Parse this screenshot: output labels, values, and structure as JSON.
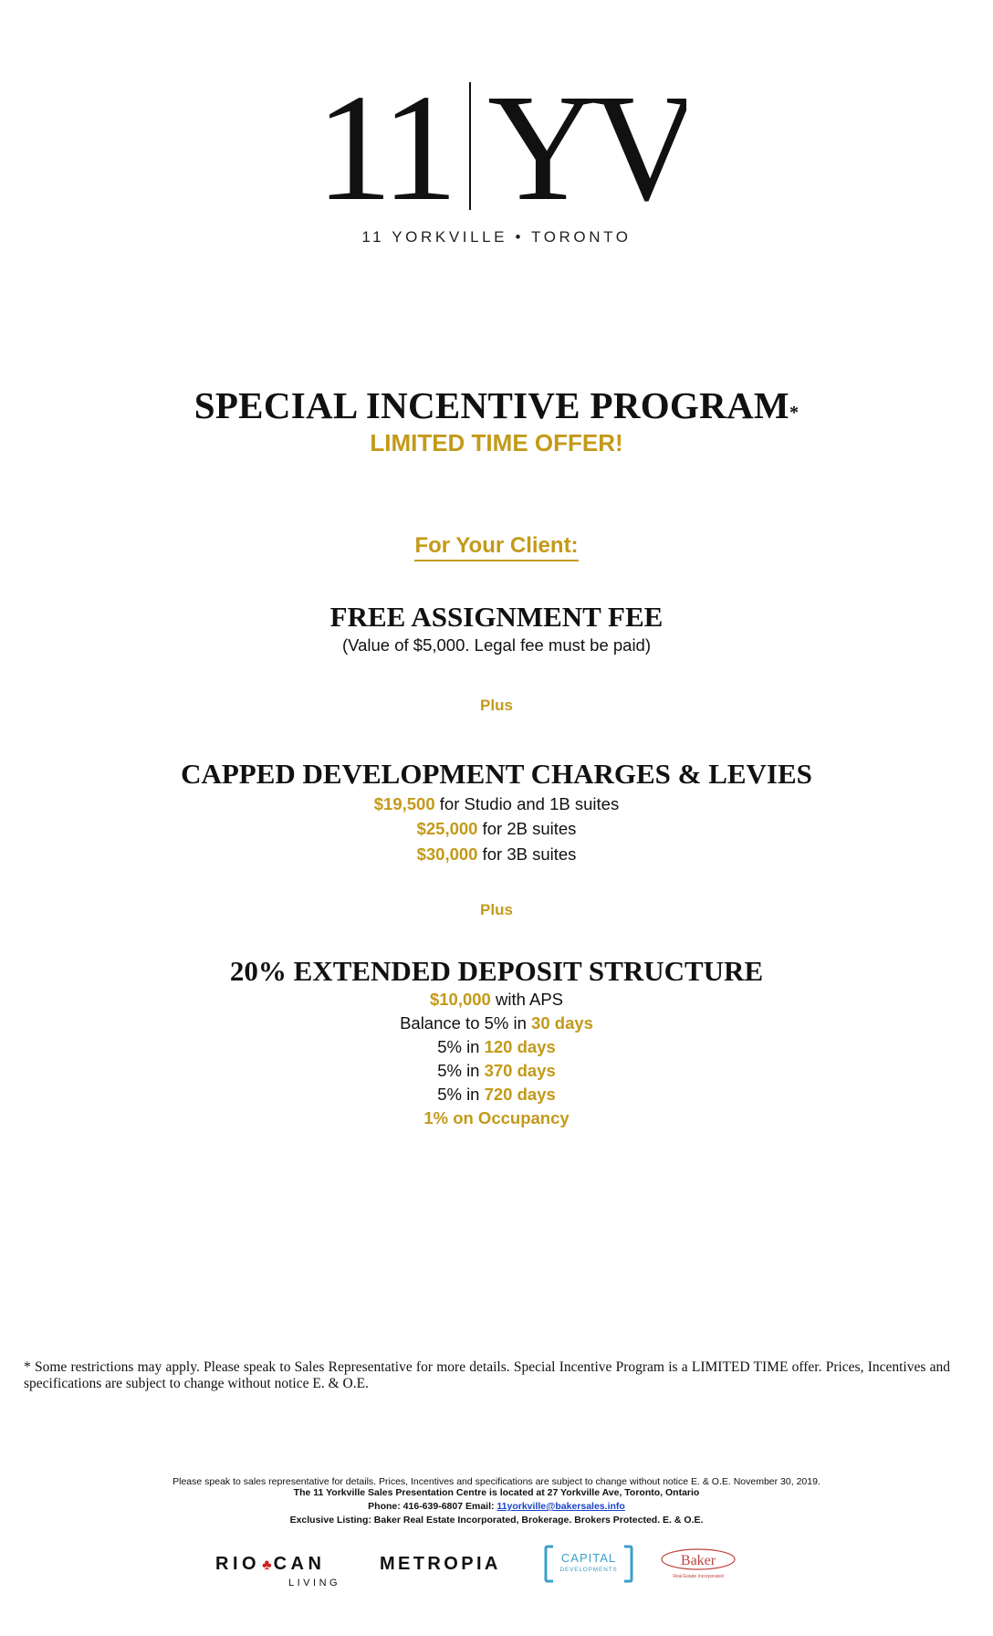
{
  "logo": {
    "left": "11",
    "right": "YV",
    "subtitle": "11 YORKVILLE • TORONTO"
  },
  "heading": {
    "title": "SPECIAL INCENTIVE PROGRAM",
    "asterisk": "*",
    "offer": "LIMITED TIME OFFER!"
  },
  "for_client": "For Your Client:",
  "assignment": {
    "title": "FREE ASSIGNMENT FEE",
    "note": "(Value of $5,000. Legal fee must be paid)"
  },
  "plus_label": "Plus",
  "capped": {
    "title": "CAPPED DEVELOPMENT CHARGES & LEVIES",
    "items": [
      {
        "amount": "$19,500",
        "text": " for Studio and 1B suites"
      },
      {
        "amount": "$25,000",
        "text": " for 2B suites"
      },
      {
        "amount": "$30,000",
        "text": " for 3B suites"
      }
    ]
  },
  "deposit": {
    "title": "20% EXTENDED DEPOSIT STRUCTURE",
    "line1": {
      "gold": "$10,000",
      "text": " with APS"
    },
    "line2": {
      "text": "Balance to 5% in ",
      "gold": "30 days"
    },
    "line3": {
      "text": "5% in ",
      "gold": "120 days"
    },
    "line4": {
      "text": "5% in ",
      "gold": "370 days"
    },
    "line5": {
      "text": "5% in ",
      "gold": "720 days"
    },
    "line6": {
      "gold": "1% on Occupancy"
    }
  },
  "footnote": "* Some restrictions may apply. Please speak to Sales Representative for more details. Special Incentive Program is a LIMITED TIME offer. Prices, Incentives and specifications are subject to change without notice E. & O.E.",
  "fine_print": {
    "line1": "Please speak to sales representative for details. Prices, Incentives and specifications are subject to change without notice E. & O.E. November 30, 2019.",
    "line2": "The 11 Yorkville Sales Presentation Centre is located at 27 Yorkville Ave, Toronto, Ontario",
    "phone": "Phone: 416-639-6807 Email: ",
    "email": "11yorkville@bakersales.info",
    "listing": "Exclusive Listing: Baker Real Estate Incorporated, Brokerage. Brokers Protected. E. & O.E."
  },
  "partners": {
    "riocan_left": "RIO",
    "riocan_right": "CAN",
    "riocan_sub": "LIVING",
    "metropia": "METROPIA",
    "capital_top": "CAPITAL",
    "capital_bottom": "DEVELOPMENTS",
    "baker": "Baker",
    "baker_sub": "Real Estate Incorporated"
  },
  "colors": {
    "gold": "#C39A19",
    "riocan_leaf": "#d01d1d",
    "capital_blue": "#3aa0c8",
    "baker_red": "#c0443f"
  }
}
